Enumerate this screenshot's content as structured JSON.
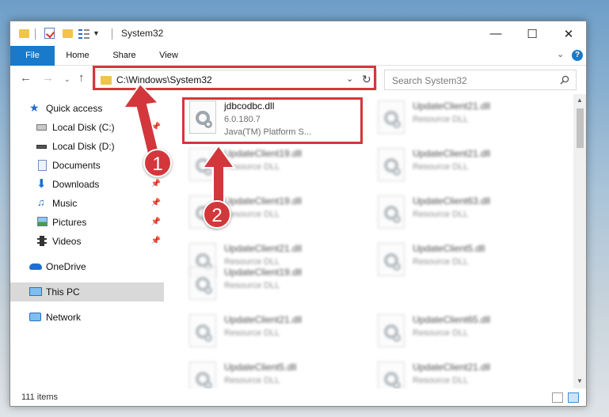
{
  "window": {
    "title": "System32",
    "controls": {
      "minimize": "—",
      "maximize": "☐",
      "close": "✕"
    }
  },
  "ribbon": {
    "tabs": [
      "File",
      "Home",
      "Share",
      "View"
    ],
    "help": "?"
  },
  "address_bar": {
    "path": "C:\\Windows\\System32",
    "search_placeholder": "Search System32"
  },
  "sidebar": {
    "items": [
      {
        "label": "Quick access",
        "icon": "star-icon",
        "pinned": false
      },
      {
        "label": "Local Disk (C:)",
        "icon": "drive-icon",
        "pinned": true
      },
      {
        "label": "Local Disk (D:)",
        "icon": "drive-icon",
        "pinned": true
      },
      {
        "label": "Documents",
        "icon": "document-icon",
        "pinned": true
      },
      {
        "label": "Downloads",
        "icon": "download-icon",
        "pinned": true
      },
      {
        "label": "Music",
        "icon": "music-icon",
        "pinned": true
      },
      {
        "label": "Pictures",
        "icon": "picture-icon",
        "pinned": true
      },
      {
        "label": "Videos",
        "icon": "video-icon",
        "pinned": true
      },
      {
        "label": "OneDrive",
        "icon": "cloud-icon",
        "pinned": false
      },
      {
        "label": "This PC",
        "icon": "computer-icon",
        "pinned": false,
        "selected": true
      },
      {
        "label": "Network",
        "icon": "network-icon",
        "pinned": false
      }
    ]
  },
  "files": {
    "highlighted": {
      "name": "jdbcodbc.dll",
      "version": "6.0.180.7",
      "description": "Java(TM) Platform S..."
    },
    "left_column": [
      {
        "name": "UpdateClient19.dll",
        "type": "Resource DLL"
      },
      {
        "name": "UpdateClient19.dll",
        "type": "Resource DLL"
      },
      {
        "name": "UpdateClient21.dll",
        "type": "Resource DLL"
      },
      {
        "name": "UpdateClient19.dll",
        "type": "Resource DLL"
      },
      {
        "name": "UpdateClient21.dll",
        "type": "Resource DLL"
      },
      {
        "name": "UpdateClient5.dll",
        "type": "Resource DLL"
      }
    ],
    "right_column": [
      {
        "name": "UpdateClient21.dll",
        "type": "Resource DLL"
      },
      {
        "name": "UpdateClient21.dll",
        "type": "Resource DLL"
      },
      {
        "name": "UpdateClient63.dll",
        "type": "Resource DLL"
      },
      {
        "name": "UpdateClient5.dll",
        "type": "Resource DLL"
      },
      {
        "name": "UpdateClient65.dll",
        "type": "Resource DLL"
      },
      {
        "name": "UpdateClient21.dll",
        "type": "Resource DLL"
      }
    ]
  },
  "status_bar": {
    "item_count": "111 items"
  },
  "callouts": {
    "one": "1",
    "two": "2"
  },
  "colors": {
    "accent": "#1979ca",
    "highlight_red": "#d3373c",
    "selected_bg": "#d9d9d9"
  }
}
